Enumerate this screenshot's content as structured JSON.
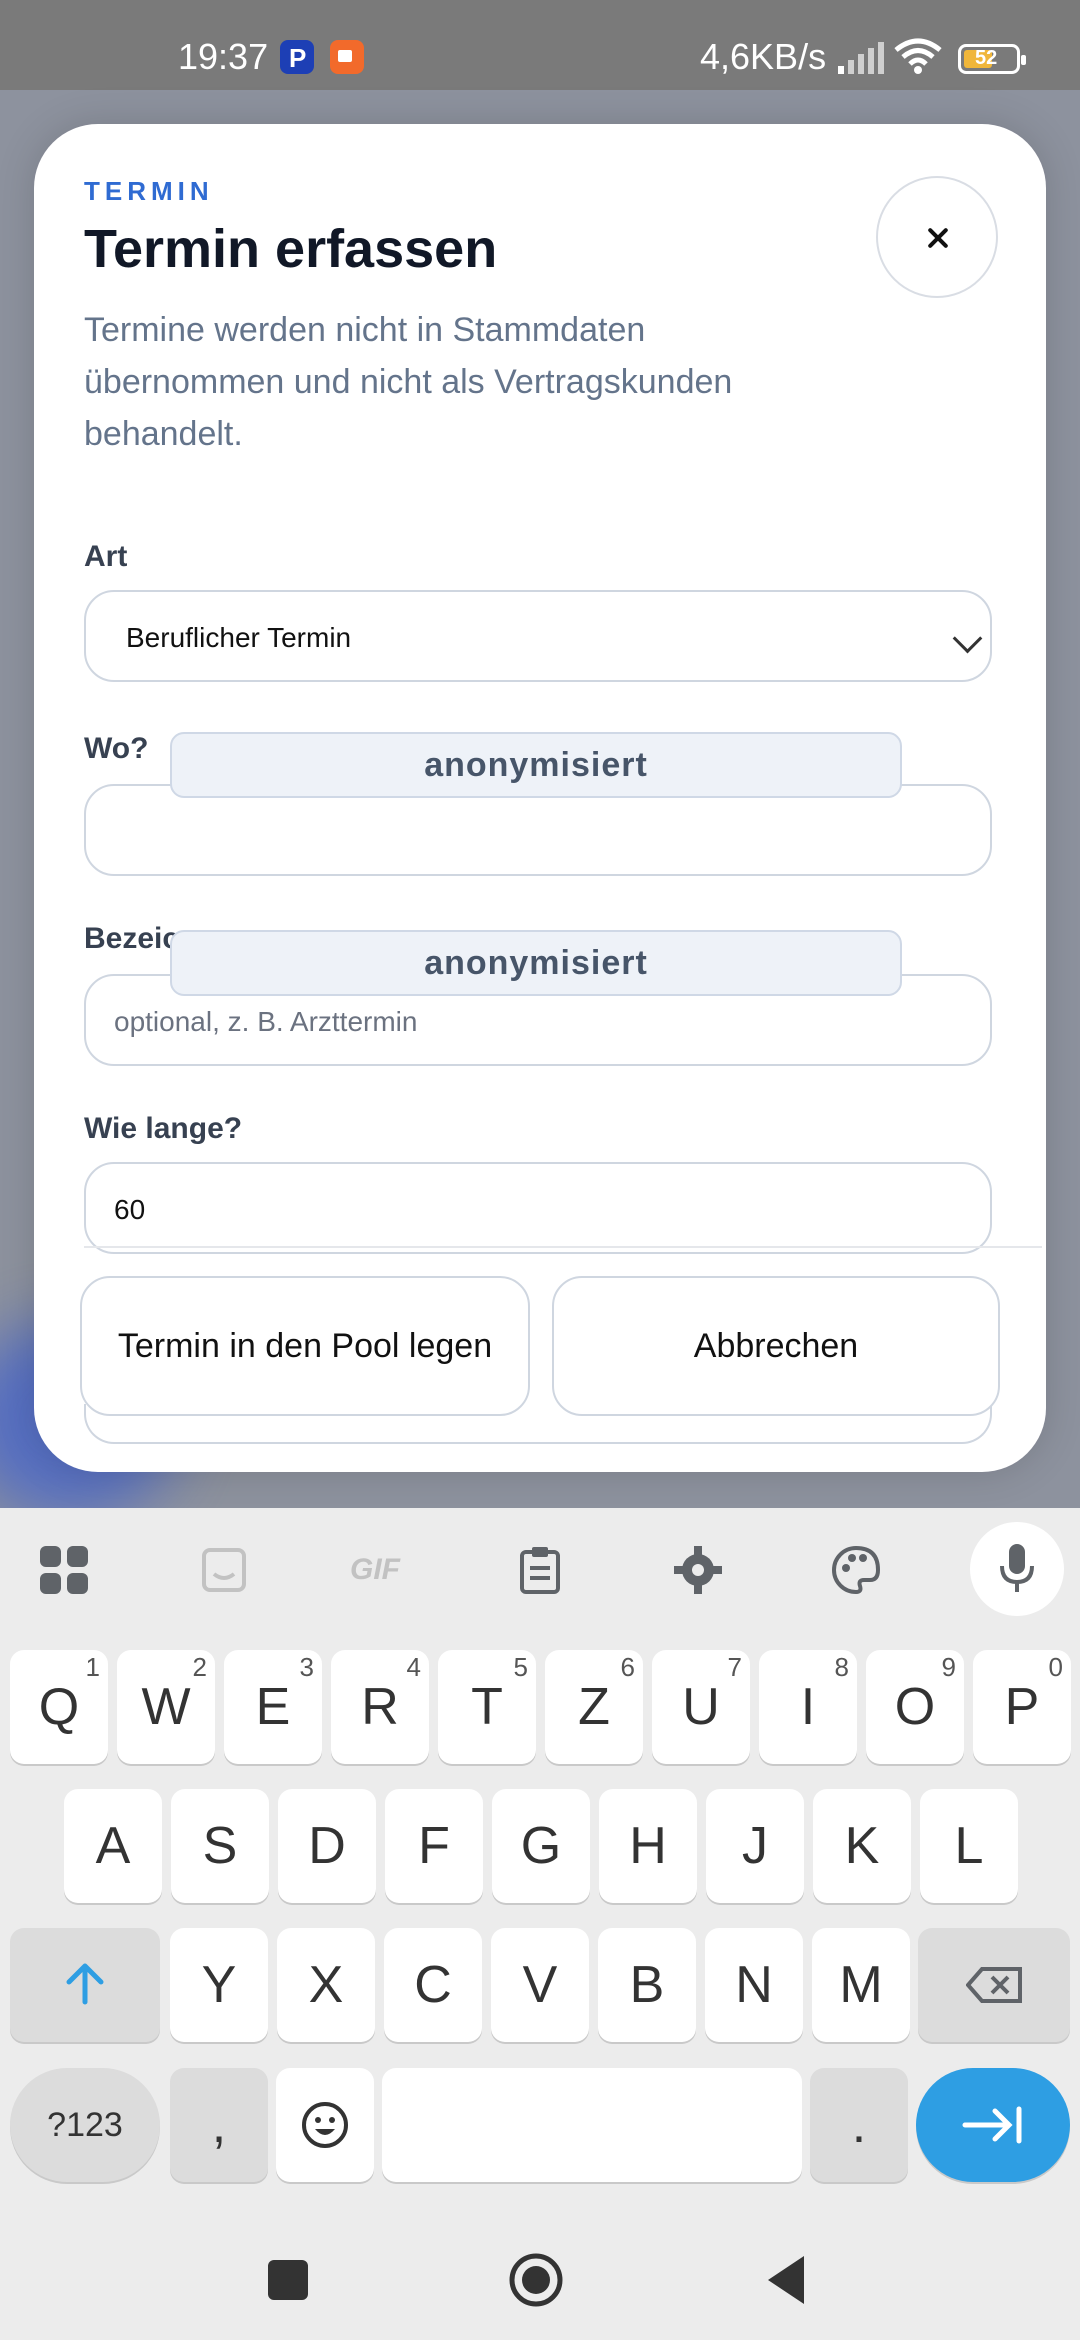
{
  "status_bar": {
    "time": "19:37",
    "network_speed": "4,6KB/s",
    "battery": "52",
    "accent_colors": {
      "paypal": "#1d3fb5",
      "recorder": "#f26a2b",
      "battery": "#f0b63a"
    }
  },
  "modal": {
    "eyebrow": "TERMIN",
    "title": "Termin erfassen",
    "subtitle": "Termine werden nicht in Stammdaten übernommen und nicht als Vertragskunden behandelt.",
    "fields": {
      "art": {
        "label": "Art",
        "value": "Beruflicher Termin"
      },
      "wo": {
        "label": "Wo?",
        "value": ""
      },
      "bezeichnung": {
        "label": "Bezeic",
        "placeholder": "optional, z. B. Arzttermin"
      },
      "dauer": {
        "label": "Wie lange?",
        "value": "60"
      }
    },
    "redaction_label": "anonymisiert",
    "buttons": {
      "pool": "Termin in den Pool legen",
      "cancel": "Abbrechen"
    }
  },
  "keyboard": {
    "toolbar": [
      "apps-icon",
      "sticker-icon",
      "gif-icon",
      "clipboard-icon",
      "settings-icon",
      "palette-icon",
      "mic-icon"
    ],
    "gif_label": "GIF",
    "row1": [
      {
        "k": "Q",
        "n": "1"
      },
      {
        "k": "W",
        "n": "2"
      },
      {
        "k": "E",
        "n": "3"
      },
      {
        "k": "R",
        "n": "4"
      },
      {
        "k": "T",
        "n": "5"
      },
      {
        "k": "Z",
        "n": "6"
      },
      {
        "k": "U",
        "n": "7"
      },
      {
        "k": "I",
        "n": "8"
      },
      {
        "k": "O",
        "n": "9"
      },
      {
        "k": "P",
        "n": "0"
      }
    ],
    "row2": [
      "A",
      "S",
      "D",
      "F",
      "G",
      "H",
      "J",
      "K",
      "L"
    ],
    "row3": [
      "Y",
      "X",
      "C",
      "V",
      "B",
      "N",
      "M"
    ],
    "symbols_label": "?123",
    "comma": ",",
    "period": ".",
    "action_color": "#2e9ee3"
  }
}
